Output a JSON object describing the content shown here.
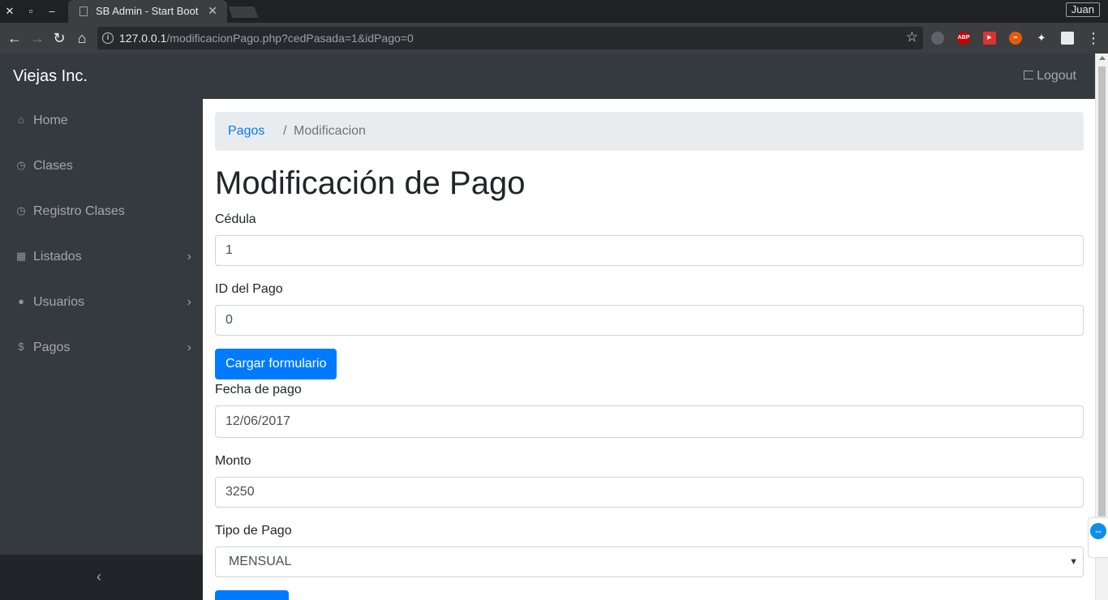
{
  "browser": {
    "tab_title": "SB Admin - Start Boot",
    "url_host": "127.0.0.1",
    "url_path": "/modificacionPago.php?cedPasada=1&idPago=0",
    "profile_name": "Juan"
  },
  "navbar": {
    "brand": "Viejas Inc.",
    "logout_label": "Logout"
  },
  "sidebar": {
    "items": [
      {
        "label": "Home",
        "icon": "home-icon",
        "has_submenu": false
      },
      {
        "label": "Clases",
        "icon": "clock-icon",
        "has_submenu": false
      },
      {
        "label": "Registro Clases",
        "icon": "clock-icon",
        "has_submenu": false
      },
      {
        "label": "Listados",
        "icon": "table-icon",
        "has_submenu": true
      },
      {
        "label": "Usuarios",
        "icon": "user-icon",
        "has_submenu": true
      },
      {
        "label": "Pagos",
        "icon": "dollar-icon",
        "has_submenu": true
      }
    ]
  },
  "breadcrumb": {
    "link": "Pagos",
    "separator": "/",
    "current": "Modificacion"
  },
  "page": {
    "title": "Modificación de Pago"
  },
  "form": {
    "cedula_label": "Cédula",
    "cedula_value": "1",
    "id_pago_label": "ID del Pago",
    "id_pago_value": "0",
    "load_button": "Cargar formulario",
    "fecha_label": "Fecha de pago",
    "fecha_value": "12/06/2017",
    "monto_label": "Monto",
    "monto_value": "3250",
    "tipo_label": "Tipo de Pago",
    "tipo_value": "MENSUAL"
  },
  "colors": {
    "navbar": "#343a40",
    "primary": "#007bff",
    "breadcrumb_bg": "#e9ecef"
  }
}
